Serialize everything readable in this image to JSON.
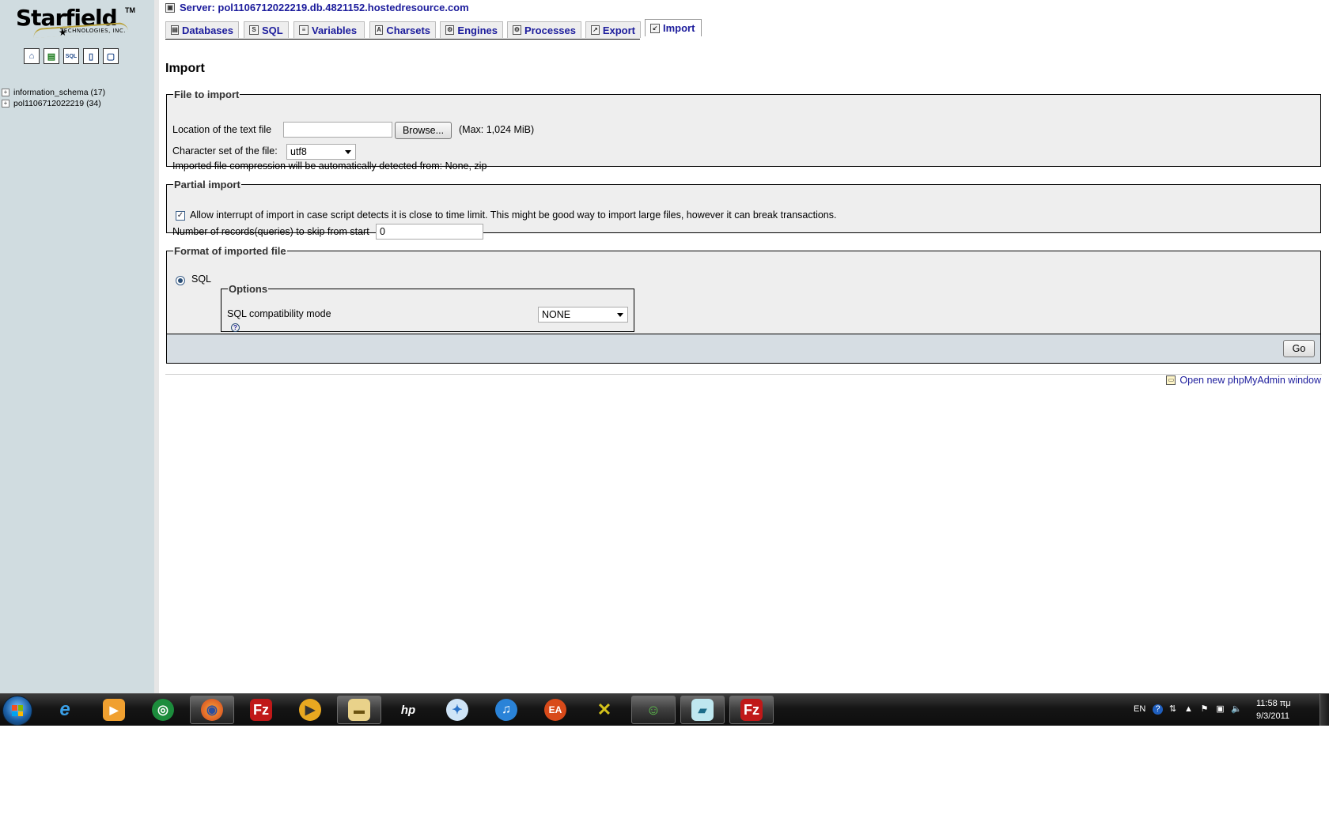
{
  "sidebar": {
    "logo": {
      "name": "Starfield",
      "tm": "TM",
      "tagline": "TECHNOLOGIES, INC."
    },
    "icons": [
      "home-icon",
      "query-window-icon",
      "sql-docs-icon",
      "documentation-icon",
      "reload-icon"
    ],
    "databases": [
      {
        "label": "information_schema (17)"
      },
      {
        "label": "pol1106712022219 (34)"
      }
    ]
  },
  "header": {
    "server_label": "Server: pol1106712022219.db.4821152.hostedresource.com"
  },
  "tabs": [
    {
      "label": "Databases",
      "icon": "databases-icon"
    },
    {
      "label": "SQL",
      "icon": "sql-icon"
    },
    {
      "label": "Variables",
      "icon": "variables-icon"
    },
    {
      "label": "Charsets",
      "icon": "charsets-icon"
    },
    {
      "label": "Engines",
      "icon": "engines-icon"
    },
    {
      "label": "Processes",
      "icon": "processes-icon"
    },
    {
      "label": "Export",
      "icon": "export-icon"
    },
    {
      "label": "Import",
      "icon": "import-icon",
      "active": true
    }
  ],
  "main": {
    "title": "Import",
    "file_to_import": {
      "legend": "File to import",
      "location_label": "Location of the text file",
      "location_value": "",
      "browse_label": "Browse...",
      "max_label": "(Max: 1,024 MiB)",
      "charset_label": "Character set of the file:",
      "charset_value": "utf8",
      "compression_note": "Imported file compression will be automatically detected from: None, zip"
    },
    "partial_import": {
      "legend": "Partial import",
      "allow_interrupt_checked": true,
      "allow_interrupt_label": "Allow interrupt of import in case script detects it is close to time limit. This might be good way to import large files, however it can break transactions.",
      "skip_label": "Number of records(queries) to skip from start",
      "skip_value": "0"
    },
    "format": {
      "legend": "Format of imported file",
      "sql_label": "SQL",
      "options_legend": "Options",
      "compat_label": "SQL compatibility mode",
      "compat_value": "NONE"
    },
    "go_label": "Go",
    "open_new_window": "Open new phpMyAdmin window"
  },
  "taskbar": {
    "apps": [
      {
        "name": "internet-explorer-icon",
        "open": false
      },
      {
        "name": "media-player-icon",
        "open": false
      },
      {
        "name": "green-app-icon",
        "open": false
      },
      {
        "name": "firefox-icon",
        "open": true
      },
      {
        "name": "filezilla-icon",
        "open": false
      },
      {
        "name": "media-center-icon",
        "open": false
      },
      {
        "name": "file-explorer-icon",
        "open": true
      },
      {
        "name": "hp-icon",
        "open": false
      },
      {
        "name": "safari-icon",
        "open": false
      },
      {
        "name": "itunes-icon",
        "open": false
      },
      {
        "name": "ea-icon",
        "open": false
      },
      {
        "name": "xfire-icon",
        "open": false
      },
      {
        "name": "messenger-icon",
        "open": true
      },
      {
        "name": "notes-icon",
        "open": true
      },
      {
        "name": "filezilla-icon",
        "open": true
      }
    ],
    "tray": {
      "language": "EN",
      "time": "11:58 πμ",
      "date": "9/3/2011"
    }
  }
}
